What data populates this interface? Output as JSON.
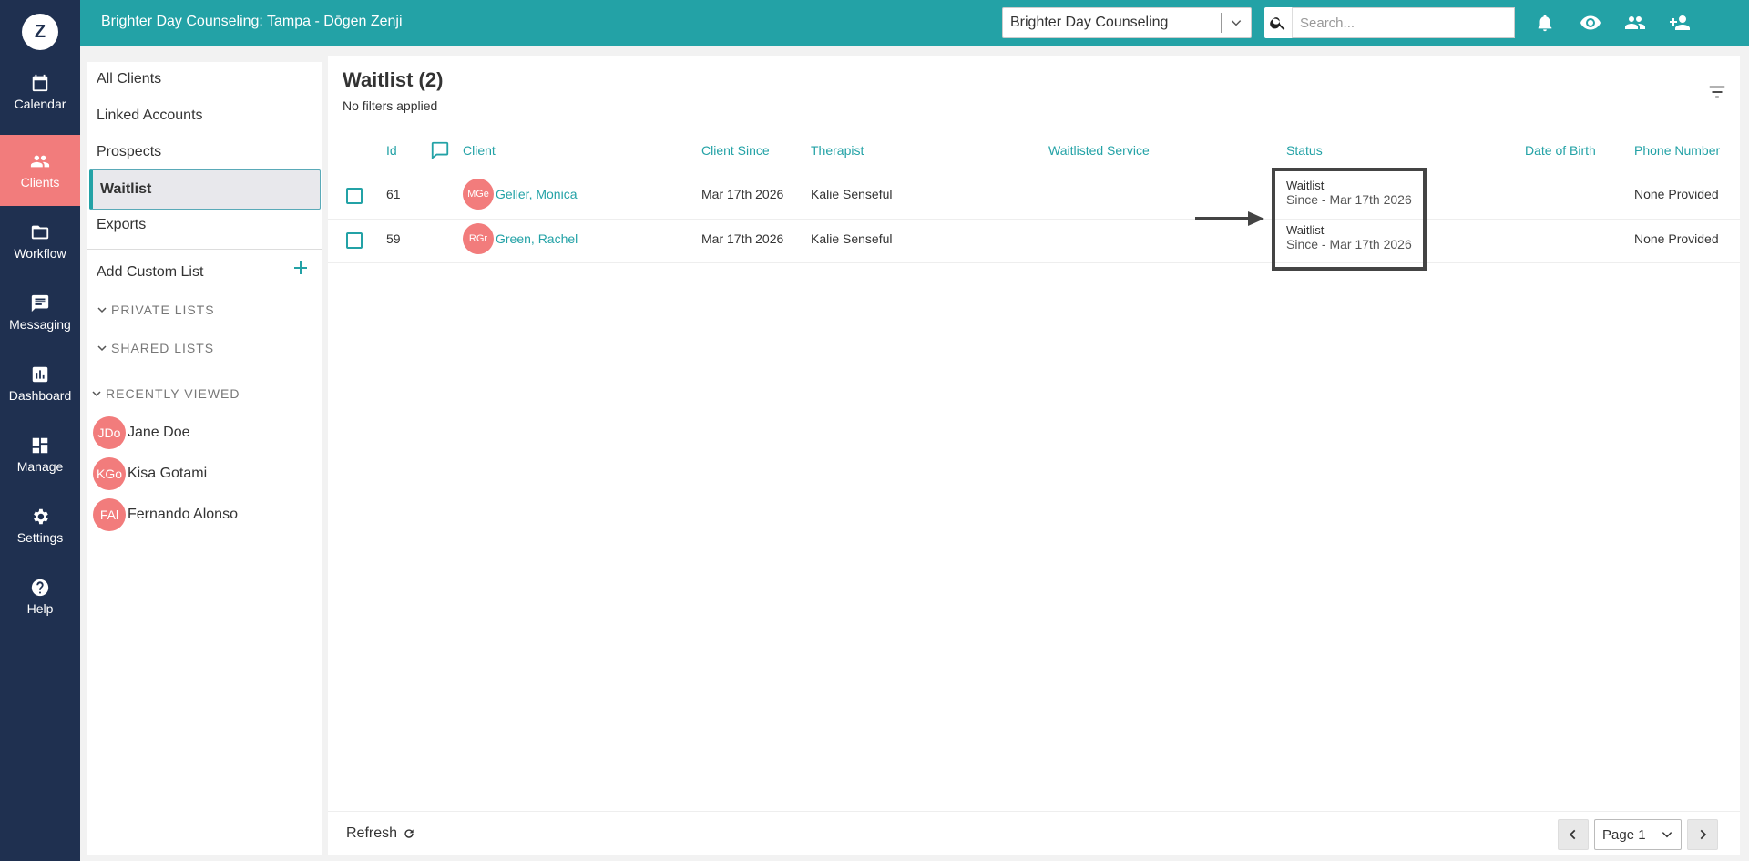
{
  "topbar": {
    "title": "Brighter Day Counseling: Tampa - Dōgen Zenji",
    "org_select": "Brighter Day Counseling",
    "search_placeholder": "Search..."
  },
  "leftnav": {
    "logo": "Z",
    "items": [
      {
        "label": "Calendar",
        "icon": "calendar-icon"
      },
      {
        "label": "Clients",
        "icon": "people-icon",
        "active": true
      },
      {
        "label": "Workflow",
        "icon": "folder-icon"
      },
      {
        "label": "Messaging",
        "icon": "message-icon"
      },
      {
        "label": "Dashboard",
        "icon": "chart-icon"
      },
      {
        "label": "Manage",
        "icon": "dashboard-icon"
      },
      {
        "label": "Settings",
        "icon": "gear-icon"
      },
      {
        "label": "Help",
        "icon": "help-icon"
      }
    ]
  },
  "sidebar": {
    "links": [
      "All Clients",
      "Linked Accounts",
      "Prospects",
      "Waitlist",
      "Exports"
    ],
    "add_custom_list": "Add Custom List",
    "private_lists": "PRIVATE LISTS",
    "shared_lists": "SHARED LISTS",
    "recently_viewed": "RECENTLY VIEWED",
    "recent": [
      {
        "initials": "JDo",
        "name": "Jane Doe"
      },
      {
        "initials": "KGo",
        "name": "Kisa Gotami"
      },
      {
        "initials": "FAl",
        "name": "Fernando Alonso"
      }
    ]
  },
  "main": {
    "title": "Waitlist (2)",
    "filters": "No filters applied",
    "columns": [
      "Id",
      "Client",
      "Client Since",
      "Therapist",
      "Waitlisted Service",
      "Status",
      "Date of Birth",
      "Phone Number"
    ],
    "rows": [
      {
        "id": "61",
        "initials": "MGe",
        "client": "Geller, Monica",
        "since": "Mar 17th 2026",
        "therapist": "Kalie Senseful",
        "service": "",
        "status": "Waitlist",
        "status_since": "Since - Mar 17th 2026",
        "dob": "",
        "phone": "None Provided"
      },
      {
        "id": "59",
        "initials": "RGr",
        "client": "Green, Rachel",
        "since": "Mar 17th 2026",
        "therapist": "Kalie Senseful",
        "service": "",
        "status": "Waitlist",
        "status_since": "Since - Mar 17th 2026",
        "dob": "",
        "phone": "None Provided"
      }
    ],
    "refresh": "Refresh",
    "page": "Page 1"
  }
}
